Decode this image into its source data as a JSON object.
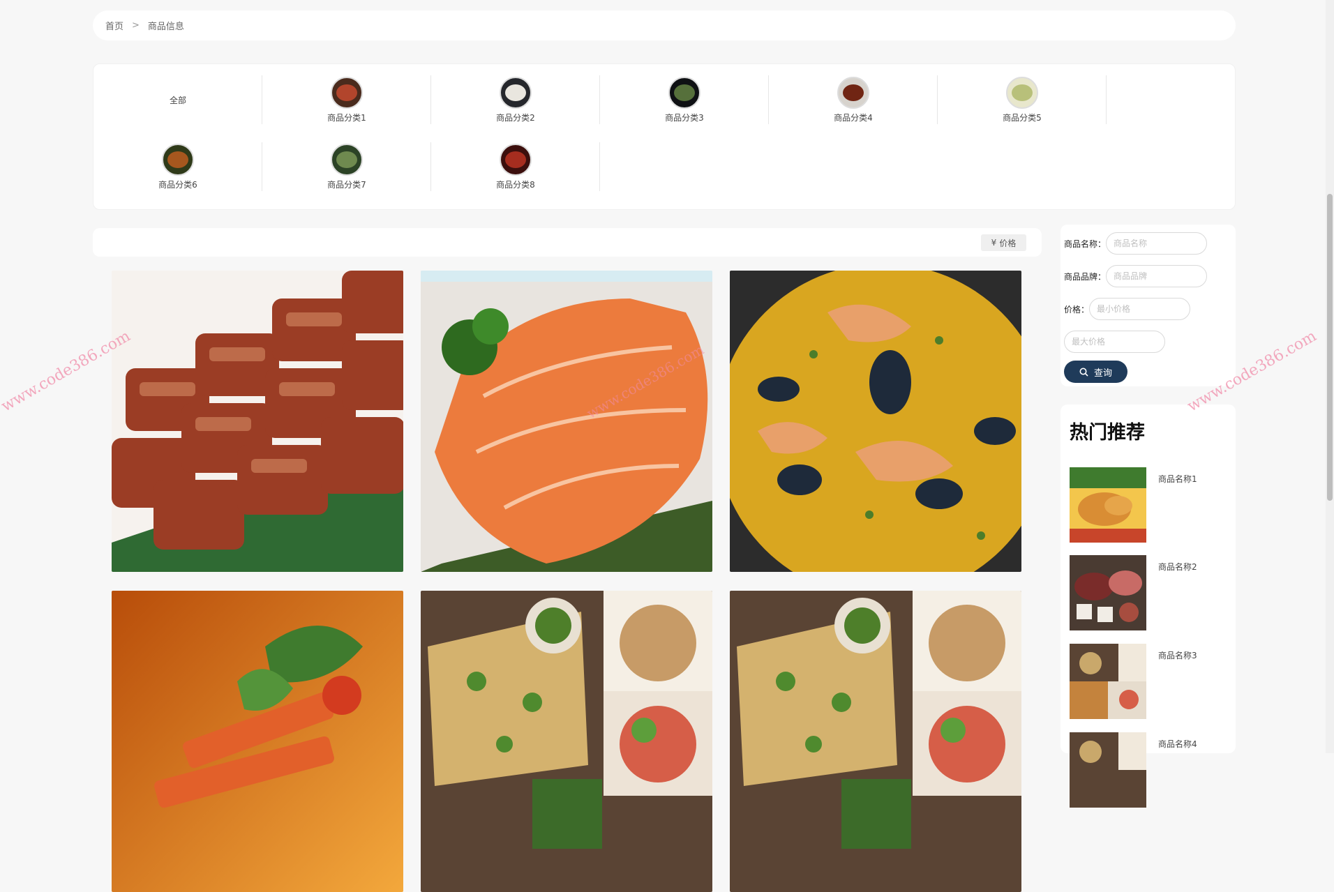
{
  "breadcrumb": {
    "home": "首页",
    "separator": ">",
    "current": "商品信息"
  },
  "categories": [
    {
      "label": "全部"
    },
    {
      "label": "商品分类1"
    },
    {
      "label": "商品分类2"
    },
    {
      "label": "商品分类3"
    },
    {
      "label": "商品分类4"
    },
    {
      "label": "商品分类5"
    },
    {
      "label": "商品分类6"
    },
    {
      "label": "商品分类7"
    },
    {
      "label": "商品分类8"
    }
  ],
  "sort": {
    "icon": "¥",
    "label": "价格"
  },
  "filter": {
    "name_label": "商品名称：",
    "name_placeholder": "商品名称",
    "brand_label": "商品品牌：",
    "brand_placeholder": "商品品牌",
    "price_label": "价格：",
    "min_price_placeholder": "最小价格",
    "max_price_placeholder": "最大价格",
    "search_label": "查询"
  },
  "hot": {
    "title": "热门推荐",
    "items": [
      {
        "name": "商品名称1"
      },
      {
        "name": "商品名称2"
      },
      {
        "name": "商品名称3"
      },
      {
        "name": "商品名称4"
      }
    ]
  },
  "watermark": "www.code386.com",
  "colors": {
    "accent": "#1f3b5a",
    "background": "#f7f7f7"
  }
}
